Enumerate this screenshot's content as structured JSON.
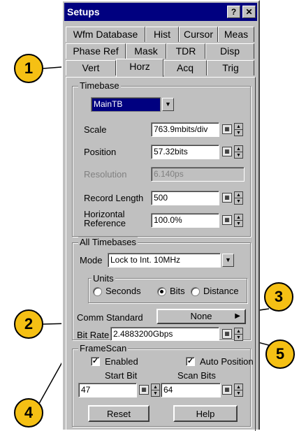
{
  "window": {
    "title": "Setups",
    "help_label": "?",
    "close_label": "✕"
  },
  "tabs": {
    "row1": [
      "Wfm Database",
      "Hist",
      "Cursor",
      "Meas"
    ],
    "row2": [
      "Phase Ref",
      "Mask",
      "TDR",
      "Disp"
    ],
    "row3": [
      "Vert",
      "Horz",
      "Acq",
      "Trig"
    ]
  },
  "timebase": {
    "group_label": "Timebase",
    "select_value": "MainTB",
    "scale_label": "Scale",
    "scale_value": "763.9mbits/div",
    "position_label": "Position",
    "position_value": "57.32bits",
    "resolution_label": "Resolution",
    "resolution_value": "6.140ps",
    "record_length_label": "Record Length",
    "record_length_value": "500",
    "horiz_ref_label_1": "Horizontal",
    "horiz_ref_label_2": "Reference",
    "horiz_ref_value": "100.0%"
  },
  "all_timebases": {
    "group_label": "All Timebases",
    "mode_label": "Mode",
    "mode_value": "Lock to Int. 10MHz",
    "units_label": "Units",
    "unit_options": [
      "Seconds",
      "Bits",
      "Distance"
    ],
    "selected_unit": "Bits",
    "comm_standard_label": "Comm Standard",
    "comm_standard_value": "None",
    "bit_rate_label": "Bit Rate",
    "bit_rate_value": "2.4883200Gbps"
  },
  "framescan": {
    "group_label": "FrameScan",
    "enabled_label": "Enabled",
    "enabled_checked": true,
    "auto_position_label": "Auto Position",
    "auto_position_checked": true,
    "start_bit_label": "Start Bit",
    "start_bit_value": "47",
    "scan_bits_label": "Scan Bits",
    "scan_bits_value": "64",
    "reset_label": "Reset",
    "help_label": "Help"
  },
  "callouts": [
    "1",
    "2",
    "3",
    "4",
    "5"
  ],
  "colors": {
    "callout_fill": "#f5c014",
    "title_bar": "#000080",
    "dialog_face": "#c0c0c0"
  }
}
